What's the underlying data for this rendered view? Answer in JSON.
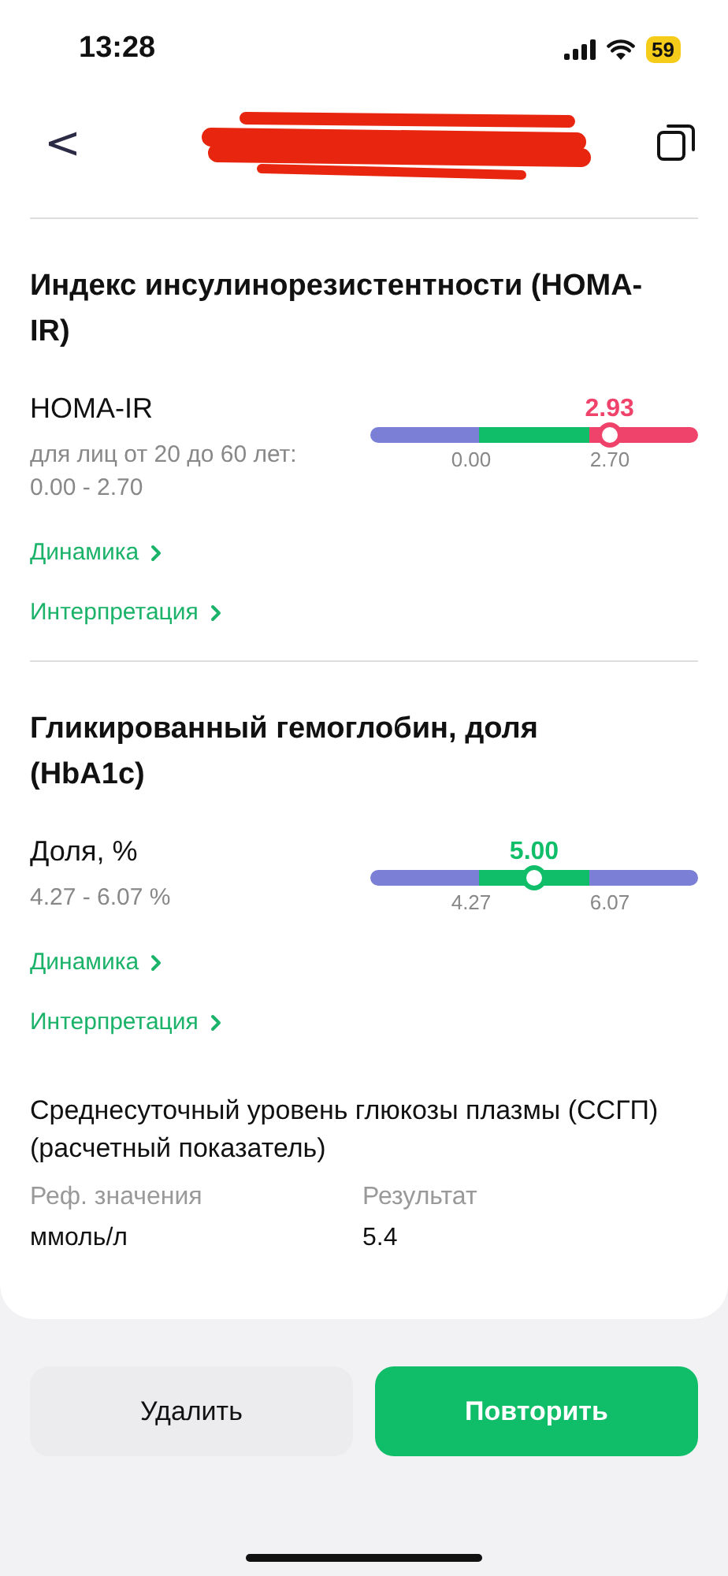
{
  "status_bar": {
    "time": "13:28",
    "battery": "59"
  },
  "header": {
    "back": "<"
  },
  "tests": [
    {
      "title": "Индекс инсулинорезистентности (HOMA-IR)",
      "name": "HOMA-IR",
      "reference": "для лиц от 20 до 60 лет: 0.00 - 2.70",
      "value": "2.93",
      "color": "#f0436b",
      "segments": [
        {
          "color": "#7b80d6"
        },
        {
          "color": "#10be6a"
        },
        {
          "color": "#f0436b"
        }
      ],
      "level": 0.73,
      "scale_labels": [
        "0.00",
        "2.70"
      ],
      "links": [
        "Динамика",
        "Интерпретация"
      ]
    },
    {
      "title": "Гликированный гемоглобин, доля (HbA1c)",
      "name": "Доля, %",
      "reference": "4.27 - 6.07 %",
      "value": "5.00",
      "color": "#10be6a",
      "segments": [
        {
          "color": "#7b80d6"
        },
        {
          "color": "#10be6a"
        },
        {
          "color": "#7b80d6"
        }
      ],
      "level": 0.5,
      "scale_labels": [
        "4.27",
        "6.07"
      ],
      "links": [
        "Динамика",
        "Интерпретация"
      ]
    }
  ],
  "calculated": {
    "title": "Среднесуточный уровень глюкозы плазмы (ССГП) (расчетный показатель)",
    "columns": [
      "Реф. значения",
      "Результат"
    ],
    "row": [
      "ммоль/л",
      "5.4"
    ]
  },
  "buttons": [
    {
      "label": "Удалить",
      "kind": "secondary"
    },
    {
      "label": "Повторить",
      "kind": "primary"
    }
  ]
}
